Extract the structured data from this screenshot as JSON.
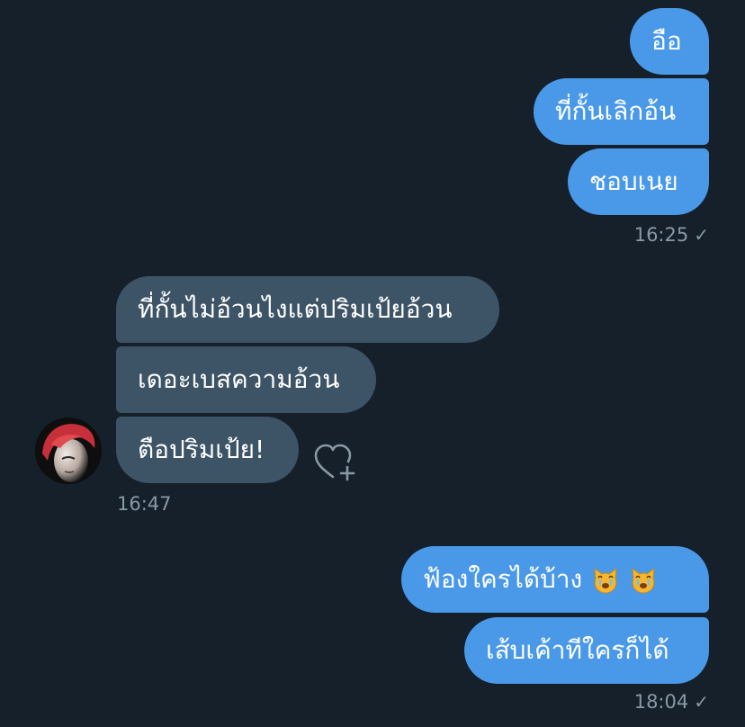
{
  "conversation": {
    "group1": {
      "messages": [
        "อือ",
        "ที่กั้นเลิกอ้น",
        "ชอบเนย"
      ],
      "time": "16:25",
      "status_glyph": "✓"
    },
    "group2": {
      "messages": [
        "ที่กั้นไม่อ้วนไงแต่ปริมเป้ยอ้วน",
        "เดอะเบสความอ้วน",
        "ตือปริมเป้ย!"
      ],
      "time": "16:47"
    },
    "group3": {
      "message1_text": "ฟ้องใครได้บ้าง",
      "message1_emoji": "crying-cat-face",
      "message2": "เส้บเค้าทีใครก็ได้",
      "time": "18:04",
      "status_glyph": "✓"
    }
  },
  "icons": {
    "reaction": "heart-plus-icon",
    "read_receipt": "checkmark-icon"
  },
  "colors": {
    "background": "#15202b",
    "sent_bubble": "#4a99e9",
    "received_bubble": "#3d5466",
    "timestamp": "#8899a6"
  }
}
